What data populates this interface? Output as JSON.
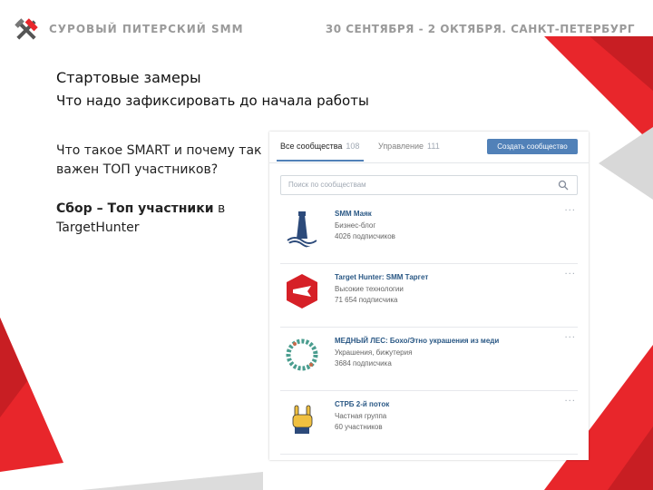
{
  "header": {
    "brand": "СУРОВЫЙ ПИТЕРСКИЙ SMM",
    "event": "30 СЕНТЯБРЯ - 2 ОКТЯБРЯ. САНКТ-ПЕТЕРБУРГ"
  },
  "slide": {
    "title": "Стартовые замеры",
    "subtitle": "Что надо зафиксировать до начала работы",
    "paragraph1": "Что такое SMART и почему так важен ТОП участников?",
    "paragraph2_bold": "Сбор – Топ участники",
    "paragraph2_rest": " в TargetHunter"
  },
  "vk": {
    "tabs": [
      {
        "label": "Все сообщества",
        "count": "108"
      },
      {
        "label": "Управление",
        "count": "111"
      }
    ],
    "create_button": "Создать сообщество",
    "search_placeholder": "Поиск по сообществам",
    "communities": [
      {
        "name": "SMM Маяк",
        "category": "Бизнес-блог",
        "members": "4026 подписчиков"
      },
      {
        "name": "Target Hunter: SMM Таргет",
        "category": "Высокие технологии",
        "members": "71 654 подписчика"
      },
      {
        "name": "МЕДНЫЙ ЛЕС: Бохо/Этно украшения из меди",
        "category": "Украшения, бижутерия",
        "members": "3684 подписчика"
      },
      {
        "name": "СТРБ 2-й поток",
        "category": "Частная группа",
        "members": "60 участников"
      }
    ],
    "more_icon": "more-horizontal-icon"
  },
  "colors": {
    "accent_red": "#e8262b",
    "vk_blue": "#5181b8",
    "vk_link": "#2a5885"
  }
}
